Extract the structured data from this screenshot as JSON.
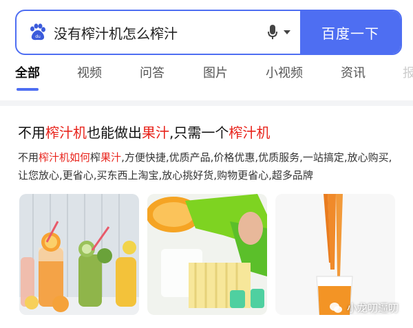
{
  "search": {
    "query": "没有榨汁机怎么榨汁",
    "button_label": "百度一下",
    "logo_icon": "baidu-paw-icon",
    "mic_icon": "microphone-icon"
  },
  "tabs": [
    {
      "label": "全部",
      "active": true
    },
    {
      "label": "视频"
    },
    {
      "label": "问答"
    },
    {
      "label": "图片"
    },
    {
      "label": "小视频"
    },
    {
      "label": "资讯"
    },
    {
      "label": "报"
    }
  ],
  "result": {
    "title_parts": [
      "不用",
      "榨汁机",
      "也能做出",
      "果汁",
      ",只需一个",
      "榨汁机"
    ],
    "desc_parts": [
      "不用",
      "榨汁机如何",
      "榨",
      "果汁",
      ",方便快捷,优质产品,价格优惠,优质服务,一站搞定,放心购买,让您放心,更省心,买东西上淘宝,放心挑好货,购物更省心,超多品牌"
    ],
    "images": [
      "juice-bottles-image",
      "citrus-squeezer-image",
      "carrot-juice-image"
    ]
  },
  "watermark": "小龙叨逼叨",
  "colors": {
    "accent": "#4e6ef2",
    "highlight": "#e8231b"
  }
}
